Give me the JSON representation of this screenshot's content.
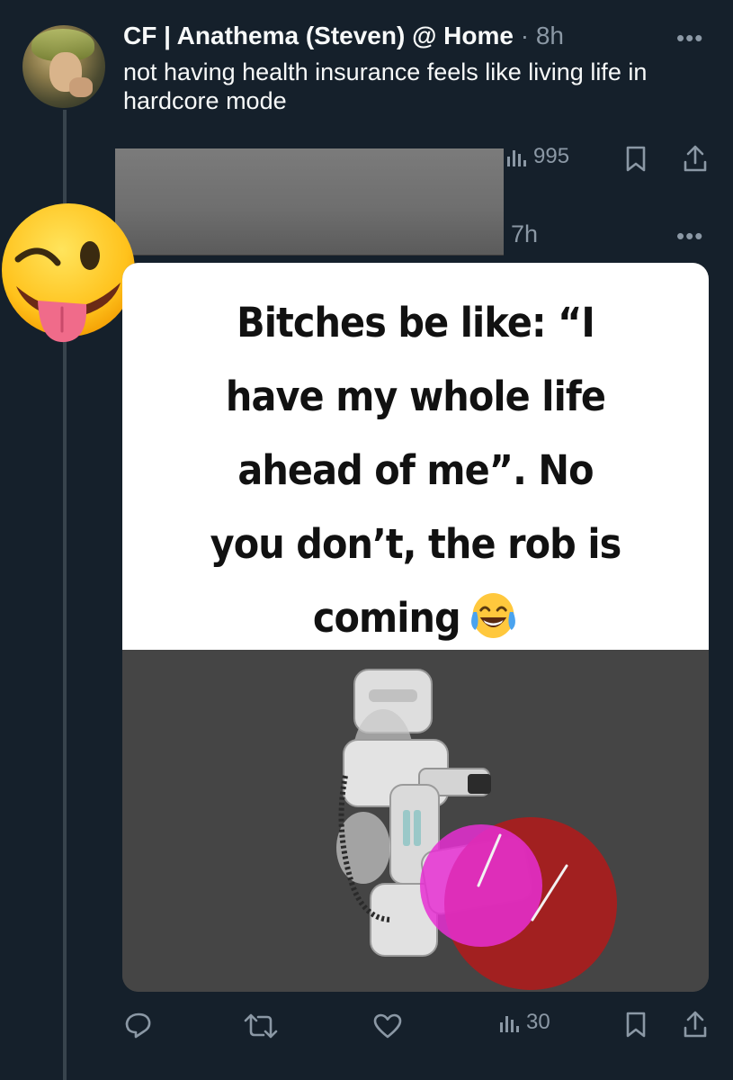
{
  "tweet": {
    "author": "CF | Anathema (Steven) @ Home",
    "time": "· 8h",
    "text": "not having health insurance feels like living life in hardcore mode",
    "views": "995"
  },
  "reply": {
    "time": "7h",
    "views": "30",
    "meme": {
      "lines": [
        "Bitches be like: “I",
        "have my whole life",
        "ahead of me”. No",
        "you don’t, the rob is",
        "coming"
      ]
    }
  },
  "icons": {
    "more": "more-icon",
    "reply": "reply-icon",
    "retweet": "retweet-icon",
    "like": "heart-icon",
    "views": "views-icon",
    "bookmark": "bookmark-icon",
    "share": "share-icon"
  },
  "colors": {
    "background": "#15202b",
    "text": "#f7f9f9",
    "muted": "#8b98a5",
    "thread_line": "#38444d"
  },
  "more_glyph": "•••"
}
